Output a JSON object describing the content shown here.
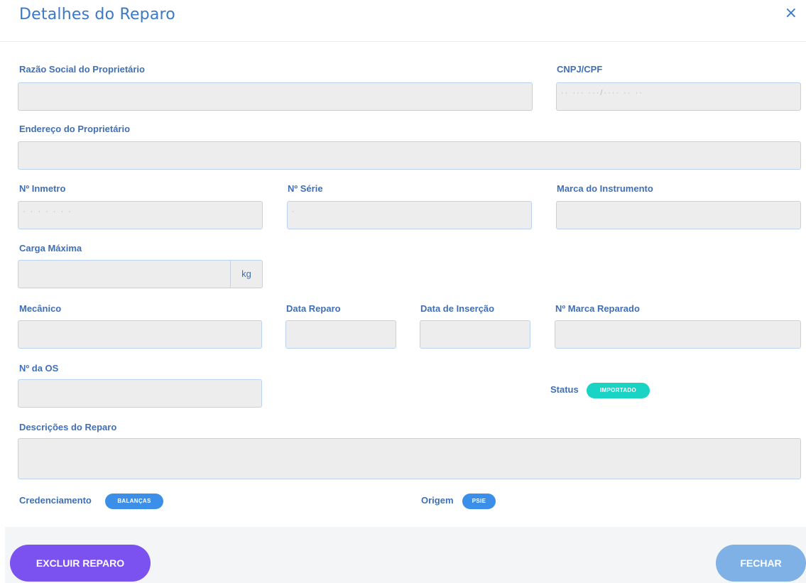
{
  "modal": {
    "title": "Detalhes do Reparo",
    "close": "×"
  },
  "fields": {
    "razao_social": {
      "label": "Razão Social do Proprietário",
      "value": ""
    },
    "cnpj": {
      "label": "CNPJ/CPF",
      "value": "·· ··· ···/···· ·· ··"
    },
    "endereco": {
      "label": "Endereço do Proprietário",
      "value": ""
    },
    "inmetro": {
      "label": "Nº Inmetro",
      "value": "· · · · · · ·"
    },
    "serie": {
      "label": "Nº Série",
      "value": "·"
    },
    "marca": {
      "label": "Marca do Instrumento",
      "value": ""
    },
    "carga": {
      "label": "Carga Máxima",
      "value": "",
      "unit": "kg"
    },
    "mecanico": {
      "label": "Mecânico",
      "value": ""
    },
    "data_reparo": {
      "label": "Data Reparo",
      "value": ""
    },
    "data_insercao": {
      "label": "Data de Inserção",
      "value": ""
    },
    "marca_reparado": {
      "label": "Nº Marca Reparado",
      "value": ""
    },
    "os": {
      "label": "Nº da OS",
      "value": ""
    },
    "descricoes": {
      "label": "Descrições do Reparo",
      "value": ""
    }
  },
  "status": {
    "label": "Status",
    "value": "IMPORTADO",
    "color": "#19d3c5"
  },
  "credenciamento": {
    "label": "Credenciamento",
    "value": "BALANÇAS",
    "color": "#3b8fe8"
  },
  "origem": {
    "label": "Origem",
    "value": "PSIE",
    "color": "#3b8fe8"
  },
  "buttons": {
    "excluir": {
      "label": "EXCLUIR REPARO",
      "color": "#7b52f0"
    },
    "fechar": {
      "label": "FECHAR",
      "color": "#7fb0e6"
    }
  }
}
